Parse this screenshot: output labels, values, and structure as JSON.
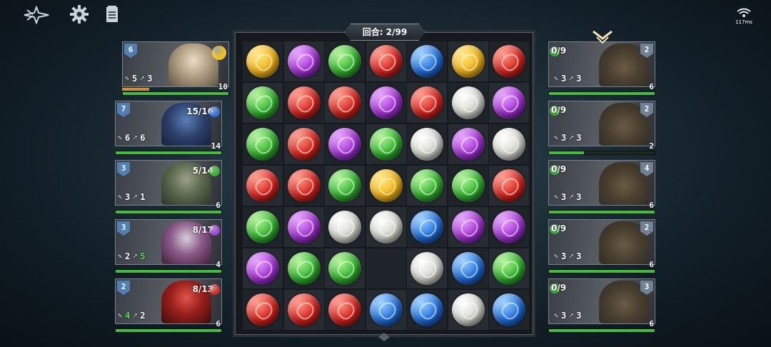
{
  "topbar": {
    "left_icons": [
      "winged-emblem-icon",
      "gear-icon",
      "notes-icon"
    ],
    "network": {
      "label": "117ms"
    }
  },
  "turn_label": "回合: 2/99",
  "heroes": [
    {
      "level": "6",
      "count": "",
      "gem": "yellow",
      "attack": "5",
      "skill": "3",
      "hp": "10",
      "hp_fraction": 1.0,
      "xp_fraction": 0.25,
      "attack_green": false,
      "skill_green": false
    },
    {
      "level": "7",
      "count": "15/16",
      "gem": "blue",
      "attack": "6",
      "skill": "6",
      "hp": "14",
      "hp_fraction": 1.0,
      "xp_fraction": 0,
      "attack_green": false,
      "skill_green": false
    },
    {
      "level": "3",
      "count": "5/14",
      "gem": "green",
      "attack": "3",
      "skill": "1",
      "hp": "6",
      "hp_fraction": 1.0,
      "xp_fraction": 0,
      "attack_green": false,
      "skill_green": false
    },
    {
      "level": "3",
      "count": "8/17",
      "gem": "purple",
      "attack": "2",
      "skill": "5",
      "hp": "4",
      "hp_fraction": 1.0,
      "xp_fraction": 0,
      "attack_green": false,
      "skill_green": true
    },
    {
      "level": "2",
      "count": "8/13",
      "gem": "red",
      "attack": "4",
      "skill": "2",
      "hp": "6",
      "hp_fraction": 1.0,
      "xp_fraction": 0,
      "attack_green": true,
      "skill_green": false
    }
  ],
  "enemies": [
    {
      "level": "2",
      "count": "0/9",
      "attack": "3",
      "skill": "3",
      "hp": "6",
      "hp_fraction": 1.0,
      "targeted": true
    },
    {
      "level": "2",
      "count": "0/9",
      "attack": "3",
      "skill": "3",
      "hp": "2",
      "hp_fraction": 0.33,
      "targeted": false
    },
    {
      "level": "4",
      "count": "0/9",
      "attack": "3",
      "skill": "3",
      "hp": "6",
      "hp_fraction": 1.0,
      "targeted": false
    },
    {
      "level": "2",
      "count": "0/9",
      "attack": "3",
      "skill": "3",
      "hp": "6",
      "hp_fraction": 1.0,
      "targeted": false
    },
    {
      "level": "3",
      "count": "0/9",
      "attack": "3",
      "skill": "3",
      "hp": "6",
      "hp_fraction": 1.0,
      "targeted": false
    }
  ],
  "board": [
    [
      "yellow",
      "purple",
      "green",
      "red",
      "blue",
      "yellow",
      "red"
    ],
    [
      "green",
      "red",
      "red",
      "purple",
      "red",
      "white",
      "purple"
    ],
    [
      "green",
      "red",
      "purple",
      "green",
      "white",
      "purple",
      "white"
    ],
    [
      "red",
      "red",
      "green",
      "yellow",
      "green",
      "green",
      "red"
    ],
    [
      "green",
      "purple",
      "white",
      "white",
      "blue",
      "purple",
      "purple"
    ],
    [
      "purple",
      "green",
      "green",
      "",
      "white",
      "blue",
      "green"
    ],
    [
      "red",
      "red",
      "red",
      "blue",
      "blue",
      "white",
      "blue"
    ]
  ]
}
